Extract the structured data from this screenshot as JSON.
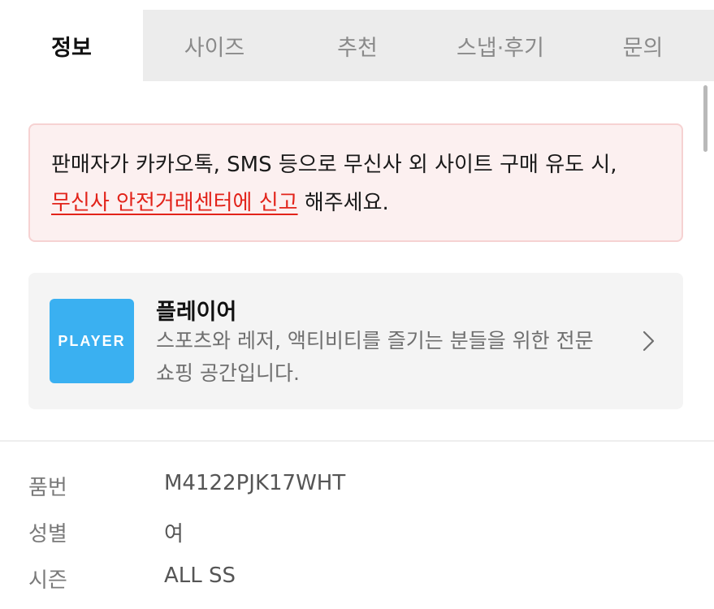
{
  "tabs": [
    {
      "label": "정보",
      "active": true
    },
    {
      "label": "사이즈",
      "active": false
    },
    {
      "label": "추천",
      "active": false
    },
    {
      "label": "스냅·후기",
      "active": false
    },
    {
      "label": "문의",
      "active": false
    }
  ],
  "warning": {
    "line1": "판매자가 카카오톡, SMS 등으로 무신사 외 사이트 구매 유도 시,",
    "link_text": "무신사 안전거래센터에 신고",
    "line2_suffix": " 해주세요."
  },
  "brand": {
    "logo_text": "PLAYER",
    "name": "플레이어",
    "description": "스포츠와 레저, 액티비티를 즐기는 분들을 위한 전문 쇼핑 공간입니다.",
    "icon": "chevron-right-icon",
    "logo_color": "#3ab0f1"
  },
  "details": [
    {
      "label": "품번",
      "value": "M4122PJK17WHT"
    },
    {
      "label": "성별",
      "value": "여"
    },
    {
      "label": "시즌",
      "value": "ALL SS"
    }
  ],
  "colors": {
    "accent_red": "#e2231a",
    "warning_bg": "#fcf0f0",
    "tab_bg": "#ececec"
  }
}
